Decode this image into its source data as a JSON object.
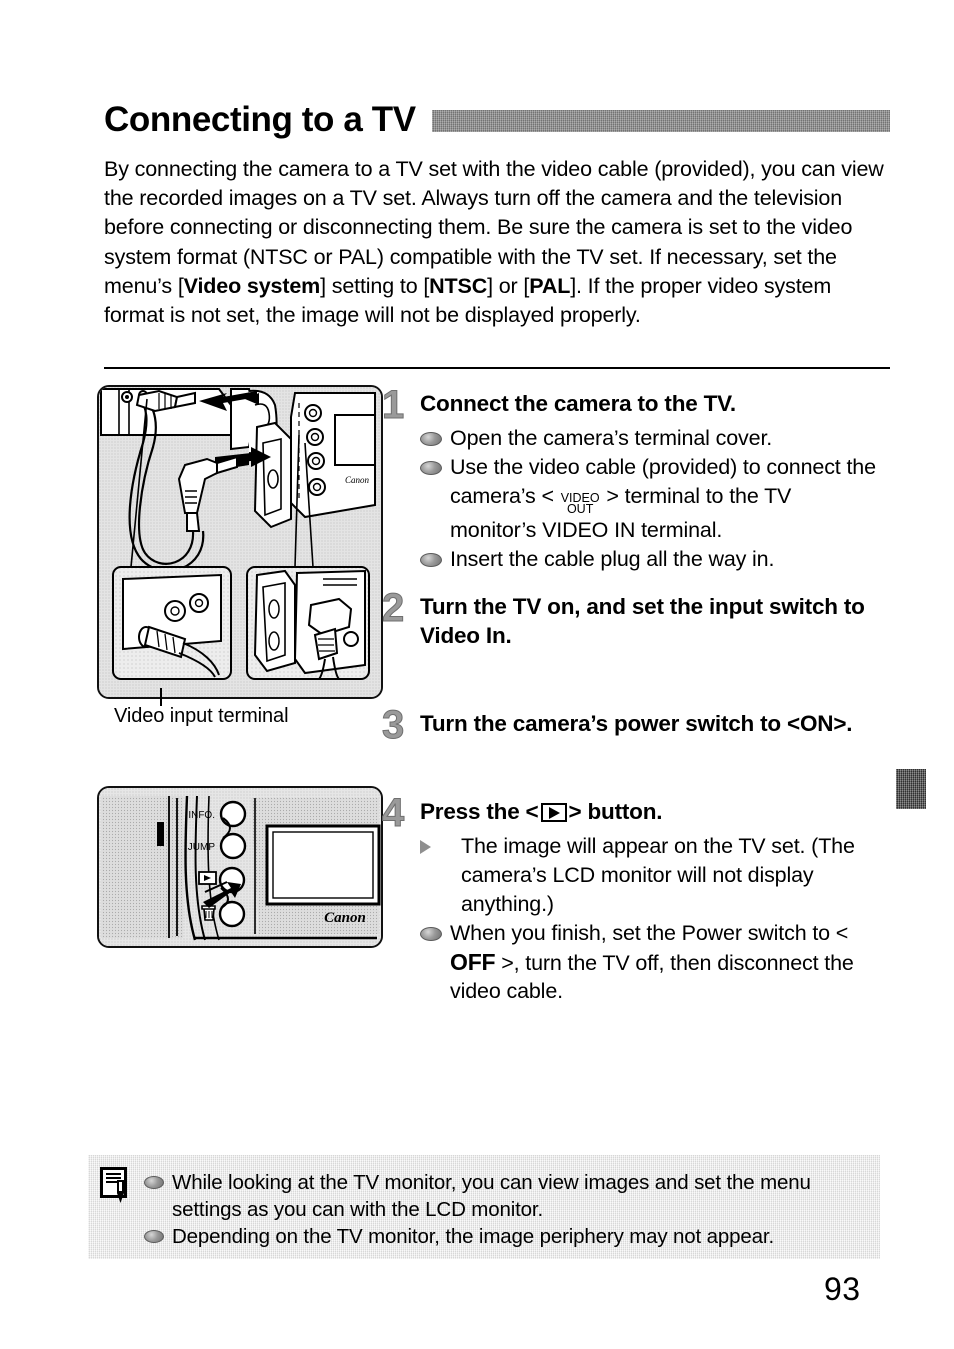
{
  "page": {
    "title": "Connecting to a TV",
    "number": "93",
    "intro_parts": [
      {
        "t": "By connecting the camera to a TV set with the video cable (provided), you can view the recorded images on a TV set. Always turn off the camera and the television before connecting or disconnecting them. Be sure the camera is set to the video system format (NTSC or PAL) compatible with the TV set. If necessary, set the menu’s [",
        "b": false
      },
      {
        "t": "Video system",
        "b": true
      },
      {
        "t": "] setting to [",
        "b": false
      },
      {
        "t": "NTSC",
        "b": true
      },
      {
        "t": "] or [",
        "b": false
      },
      {
        "t": "PAL",
        "b": true
      },
      {
        "t": "]. If the proper video system format is not set, the image will not be displayed properly.",
        "b": false
      }
    ]
  },
  "figures": {
    "connect": {
      "caption": "Video input terminal",
      "alt": "Camera terminal cover opened with video cable plug being inserted into the VIDEO OUT terminal, and inset views of the TV video input jack"
    },
    "buttons": {
      "alt": "Camera back showing INFO, JUMP, playback and erase buttons next to the LCD monitor",
      "labels": {
        "info": "INFO.",
        "jump": "JUMP",
        "brand": "Canon"
      }
    }
  },
  "steps": [
    {
      "num": "1",
      "title_pre": "Connect the camera to the TV.",
      "bullets": [
        {
          "type": "dot",
          "parts": [
            {
              "t": "Open the camera’s terminal cover."
            }
          ]
        },
        {
          "type": "dot",
          "parts": [
            {
              "t": "Use the video cable (provided) to connect the camera’s < "
            },
            {
              "glyph": "videoout",
              "line1": "VIDEO",
              "line2": "OUT"
            },
            {
              "t": " > terminal to the TV monitor’s VIDEO IN terminal."
            }
          ]
        },
        {
          "type": "dot",
          "parts": [
            {
              "t": "Insert the cable plug all the way in."
            }
          ]
        }
      ]
    },
    {
      "num": "2",
      "title_pre": "Turn the TV on, and set the input switch to Video In.",
      "bullets": []
    },
    {
      "num": "3",
      "title_pre": "Turn the camera’s power switch to <ON>.",
      "bullets": []
    },
    {
      "num": "4",
      "title_parts": [
        {
          "t": "Press the <"
        },
        {
          "glyph": "play"
        },
        {
          "t": "> button."
        }
      ],
      "bullets": [
        {
          "type": "tri",
          "parts": [
            {
              "t": "The image will appear on the TV set. (The camera’s LCD monitor will not display anything.)"
            }
          ]
        },
        {
          "type": "dot",
          "parts": [
            {
              "t": "When you finish, set the Power switch to < "
            },
            {
              "glyph": "off",
              "text": "OFF"
            },
            {
              "t": " >, turn the TV off, then disconnect the video cable."
            }
          ]
        }
      ]
    }
  ],
  "note": {
    "icon": "note-pencil-icon",
    "items": [
      "While looking at the TV monitor, you can view images and set the menu settings as you can with the LCD monitor.",
      "Depending on the TV monitor, the image periphery may not appear."
    ]
  },
  "colors": {
    "text": "#000000",
    "title_bar": "#8d8d8d",
    "step_number": "#9a9a9a",
    "note_background": "#ebebeb",
    "figure_background": "#efefef",
    "margin_tab": "#4a4a4a"
  }
}
